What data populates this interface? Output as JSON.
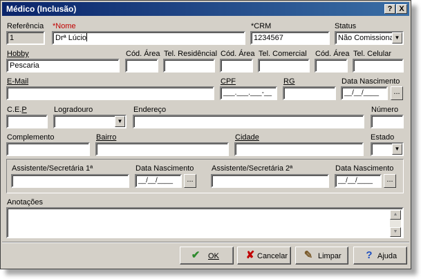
{
  "window": {
    "title": "Médico (Inclusão)",
    "help_btn": "?",
    "close_btn": "X"
  },
  "form": {
    "referencia": {
      "label": "Referência",
      "value": "1"
    },
    "nome": {
      "label": "*Nome",
      "value": "Drª Lúcio"
    },
    "crm": {
      "label": "*CRM",
      "value": "1234567"
    },
    "status": {
      "label": "Status",
      "value": "Não Comissionado"
    },
    "hobby": {
      "label": "Hobby",
      "value": "Pescaria"
    },
    "cod_area_res": {
      "label": "Cód. Área",
      "value": ""
    },
    "tel_residencial": {
      "label": "Tel. Residêncial",
      "value": ""
    },
    "cod_area_com": {
      "label": "Cód. Área",
      "value": ""
    },
    "tel_comercial": {
      "label": "Tel. Comercial",
      "value": ""
    },
    "cod_area_cel": {
      "label": "Cód. Área",
      "value": ""
    },
    "tel_celular": {
      "label": "Tel. Celular",
      "value": ""
    },
    "email": {
      "label": "E-Mail",
      "value": ""
    },
    "cpf": {
      "label": "CPF",
      "value": "___.___.___-__"
    },
    "rg": {
      "label": "RG",
      "value": ""
    },
    "data_nascimento": {
      "label": "Data Nascimento",
      "value": "__/__/____"
    },
    "cep": {
      "label": "C.E.P",
      "value": ""
    },
    "logradouro": {
      "label": "Logradouro",
      "value": ""
    },
    "endereco": {
      "label": "Endereço",
      "value": ""
    },
    "numero": {
      "label": "Número",
      "value": ""
    },
    "complemento": {
      "label": "Complemento",
      "value": ""
    },
    "bairro": {
      "label": "Bairro",
      "value": ""
    },
    "cidade": {
      "label": "Cidade",
      "value": ""
    },
    "estado": {
      "label": "Estado",
      "value": ""
    },
    "assistente1": {
      "label": "Assistente/Secretária 1ª",
      "value": ""
    },
    "assistente1_nasc": {
      "label": "Data Nascimento",
      "value": "__/__/____"
    },
    "assistente2": {
      "label": "Assistente/Secretária 2ª",
      "value": ""
    },
    "assistente2_nasc": {
      "label": "Data Nascimento",
      "value": "__/__/____"
    },
    "anotacoes": {
      "label": "Anotações",
      "value": ""
    }
  },
  "buttons": {
    "ok": "OK",
    "cancelar": "Cancelar",
    "limpar": "Limpar",
    "ajuda": "Ajuda",
    "ellipsis": "..."
  },
  "colors": {
    "title_start": "#0a246a",
    "title_end": "#3a6ea5",
    "face": "#d4d0c8",
    "required": "#c00000",
    "ok_check": "#2e8b2e",
    "cancel_x": "#c00000",
    "help_q": "#1f4fbf"
  }
}
